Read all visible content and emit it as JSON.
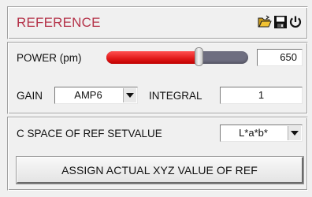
{
  "panel": {
    "title": "REFERENCE"
  },
  "toolbar": {
    "icons": [
      "folder-open-icon",
      "save-icon",
      "power-icon"
    ]
  },
  "power": {
    "label": "POWER (pm)",
    "value": "650",
    "slider_fraction": 0.65,
    "fill_color": "#e01818",
    "track_color": "#6e6e80"
  },
  "gain": {
    "label": "GAIN",
    "selected": "AMP6"
  },
  "integral": {
    "label": "INTEGRAL",
    "value": "1"
  },
  "color_space": {
    "label": "C SPACE OF REF SETVALUE",
    "selected": "L*a*b*"
  },
  "assign_button": {
    "label": "ASSIGN ACTUAL XYZ VALUE OF REF"
  },
  "colors": {
    "title": "#b5344a"
  }
}
